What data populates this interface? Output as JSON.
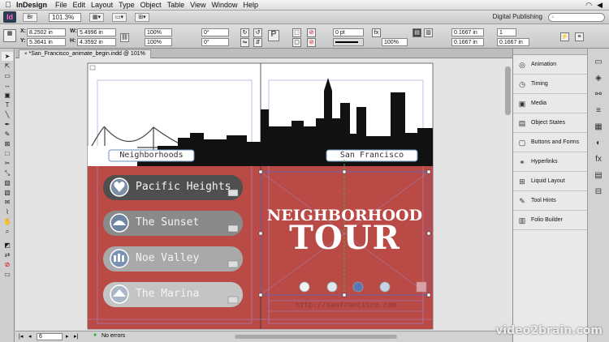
{
  "menubar": {
    "apple": "",
    "items": [
      "InDesign",
      "File",
      "Edit",
      "Layout",
      "Type",
      "Object",
      "Table",
      "View",
      "Window",
      "Help"
    ]
  },
  "appbar": {
    "logo": "Id",
    "zoom": "101.3%",
    "workspace": "Digital Publishing",
    "search_placeholder": ""
  },
  "control": {
    "x": "8.2502 in",
    "y": "5.3641 in",
    "w": "5.4996 in",
    "h": "4.3592 in",
    "scale_x": "100%",
    "scale_y": "100%",
    "rotate": "0°",
    "shear": "0°",
    "stroke": "0 pt",
    "opacity": "100%",
    "offset1": "0.1667 in",
    "offset2": "0.1667 in",
    "num": "1"
  },
  "document": {
    "tab_title": "*San_Francisco_animate_begin.indd @ 101%"
  },
  "page": {
    "left_label": "Neighborhoods",
    "right_label": "San Francisco",
    "neighborhoods": [
      "Pacific Heights",
      "The Sunset",
      "Noe Valley",
      "The Marina"
    ],
    "title_line1": "NEIGHBORHOOD",
    "title_line2": "TOUR",
    "url": "http://sanfrancisco.com"
  },
  "status": {
    "page_num": "6",
    "errors": "No errors"
  },
  "panels": {
    "items": [
      "Animation",
      "Timing",
      "Media",
      "Object States",
      "Buttons and Forms",
      "Hyperlinks",
      "Liquid Layout",
      "Tool Hints",
      "Folio Builder"
    ]
  },
  "watermark": "video2brain.com",
  "colors": {
    "page_red": "#b94a45",
    "pill_dark": "#4f4f4f",
    "pill_mid": "#9a9a9a",
    "pill_light": "#c2c2c2"
  }
}
